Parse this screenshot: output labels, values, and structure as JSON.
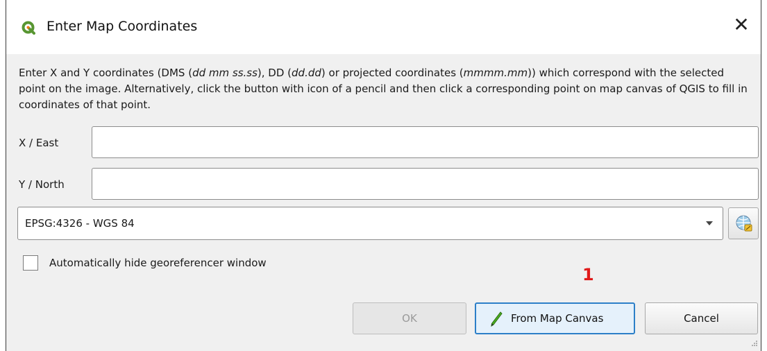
{
  "window": {
    "title": "Enter Map Coordinates",
    "icon": "qgis-logo-icon",
    "close_glyph": "✕"
  },
  "description": {
    "p1": "Enter X and Y coordinates (DMS (",
    "i1": "dd mm ss.ss",
    "p2": "), DD (",
    "i2": "dd.dd",
    "p3": ") or projected coordinates (",
    "i3": "mmmm.mm",
    "p4": ")) which correspond with the selected point on the image. Alternatively, click the button with icon of a pencil and then click a corresponding point on map canvas of QGIS to fill in coordinates of that point."
  },
  "fields": {
    "x_label": "X / East",
    "x_value": "",
    "y_label": "Y / North",
    "y_value": ""
  },
  "crs": {
    "selected": "EPSG:4326 - WGS 84",
    "button_icon": "projection-selector-icon"
  },
  "checkbox": {
    "label": "Automatically hide georeferencer window",
    "checked": false
  },
  "annotation": {
    "marker": "1",
    "color": "#e01a1a"
  },
  "buttons": {
    "ok": "OK",
    "from_map_canvas": "From Map Canvas",
    "from_map_canvas_icon": "pencil-icon",
    "cancel": "Cancel"
  }
}
